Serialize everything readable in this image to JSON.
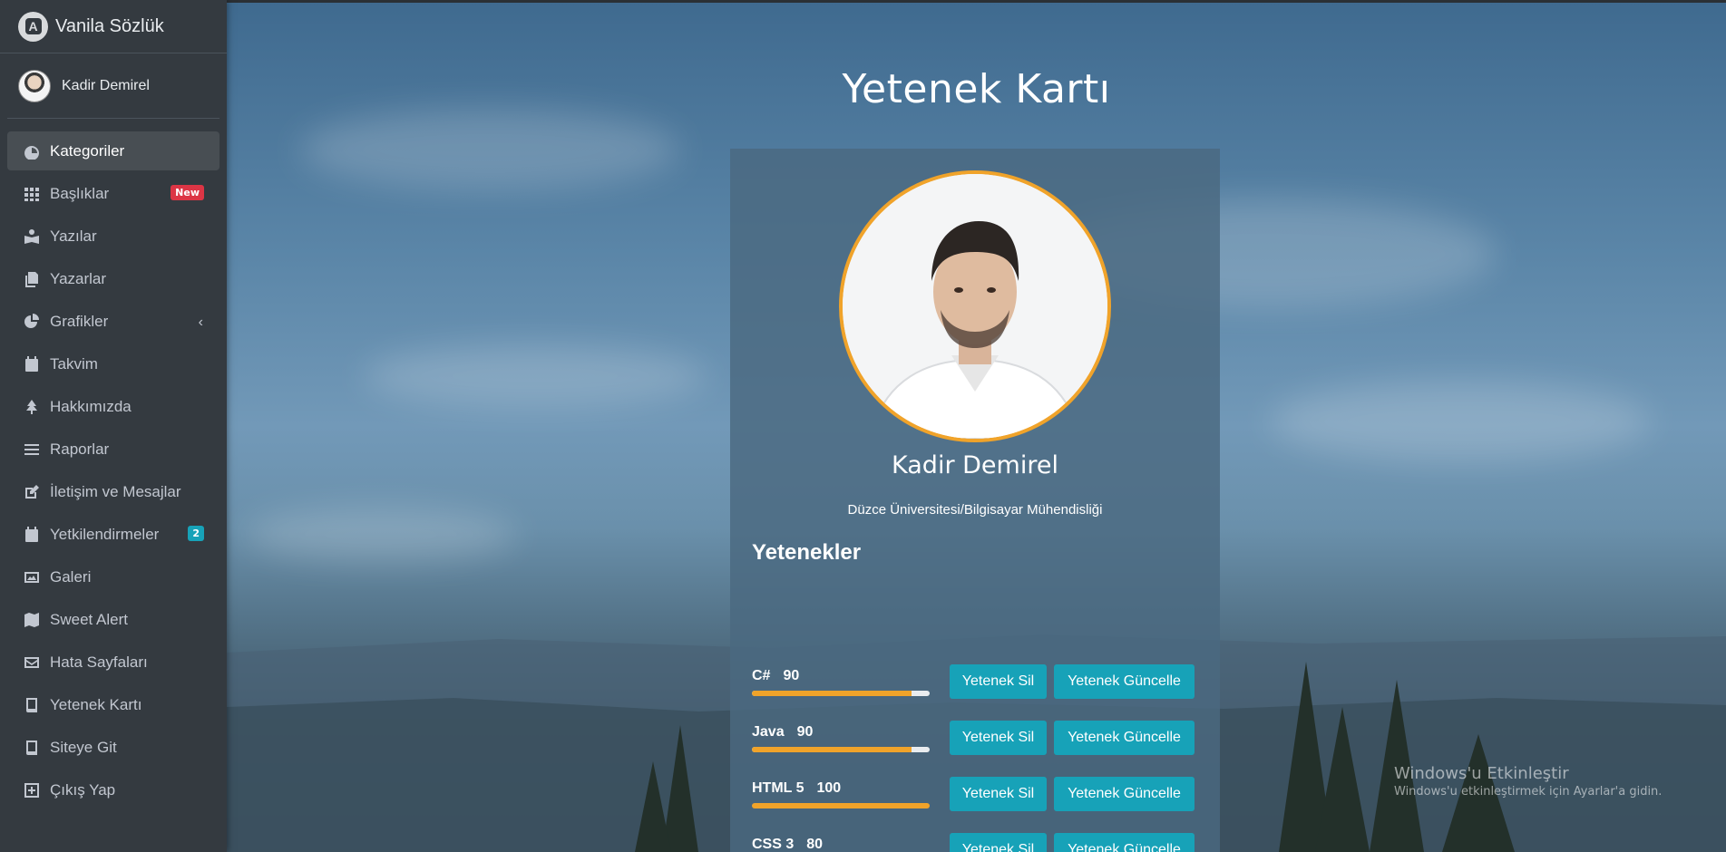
{
  "brand": {
    "title": "Vanila Sözlük",
    "logo_letter": "A"
  },
  "user": {
    "name": "Kadir Demirel"
  },
  "sidebar": {
    "items": [
      {
        "label": "Kategoriler",
        "icon": "dashboard-icon",
        "active": true
      },
      {
        "label": "Başlıklar",
        "icon": "grid-icon",
        "badge": "New"
      },
      {
        "label": "Yazılar",
        "icon": "book-reader-icon"
      },
      {
        "label": "Yazarlar",
        "icon": "copy-icon"
      },
      {
        "label": "Grafikler",
        "icon": "pie-chart-icon",
        "chevron": "‹"
      },
      {
        "label": "Takvim",
        "icon": "calendar-icon"
      },
      {
        "label": "Hakkımızda",
        "icon": "tree-icon"
      },
      {
        "label": "Raporlar",
        "icon": "list-icon"
      },
      {
        "label": "İletişim ve Mesajlar",
        "icon": "edit-icon"
      },
      {
        "label": "Yetkilendirmeler",
        "icon": "calendar-grid-icon",
        "badge": "2"
      },
      {
        "label": "Galeri",
        "icon": "image-icon"
      },
      {
        "label": "Sweet Alert",
        "icon": "map-icon"
      },
      {
        "label": "Hata Sayfaları",
        "icon": "envelope-icon"
      },
      {
        "label": "Yetenek Kartı",
        "icon": "book-icon"
      },
      {
        "label": "Siteye Git",
        "icon": "book-icon"
      },
      {
        "label": "Çıkış Yap",
        "icon": "plus-square-icon"
      }
    ]
  },
  "main": {
    "title": "Yetenek Kartı",
    "profile": {
      "name": "Kadir Demirel",
      "school": "Düzce Üniversitesi/Bilgisayar Mühendisliği"
    },
    "skills_heading": "Yetenekler",
    "delete_label": "Yetenek Sil",
    "update_label": "Yetenek Güncelle",
    "skills": [
      {
        "name": "C#",
        "value": 90
      },
      {
        "name": "Java",
        "value": 90
      },
      {
        "name": "HTML 5",
        "value": 100
      },
      {
        "name": "CSS 3",
        "value": 80
      }
    ]
  },
  "watermark": {
    "title": "Windows'u Etkinleştir",
    "subtitle": "Windows'u etkinleştirmek için Ayarlar'a gidin."
  },
  "colors": {
    "sidebar_bg": "#343a40",
    "accent_orange": "#f0a32a",
    "button_teal": "#17a2b8",
    "badge_red": "#dc3545"
  }
}
